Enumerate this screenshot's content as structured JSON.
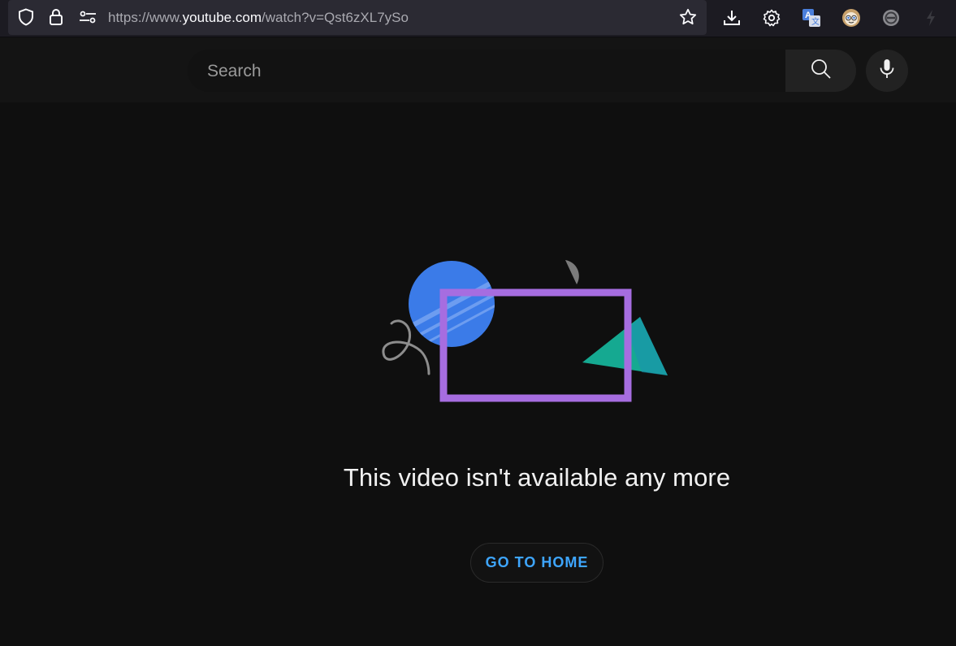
{
  "browser": {
    "url_prefix": "https://www.",
    "url_host": "youtube.com",
    "url_path": "/watch?v=Qst6zXL7ySo",
    "icons": [
      "shield-icon",
      "lock-icon",
      "permissions-icon",
      "bookmark-star-icon",
      "download-icon",
      "gear-icon",
      "translate-icon",
      "extension-avatar-icon",
      "blocker-icon",
      "lightning-icon"
    ]
  },
  "masthead": {
    "search_placeholder": "Search",
    "icons": [
      "search-icon",
      "microphone-icon"
    ]
  },
  "error": {
    "message": "This video isn't available any more",
    "home_button_label": "GO TO HOME"
  },
  "colors": {
    "background": "#0f0f0f",
    "accent_link": "#3ea6ff",
    "illustration_circle": "#3b7be8",
    "illustration_frame": "#a66de0",
    "illustration_triangle": "#15a991"
  }
}
